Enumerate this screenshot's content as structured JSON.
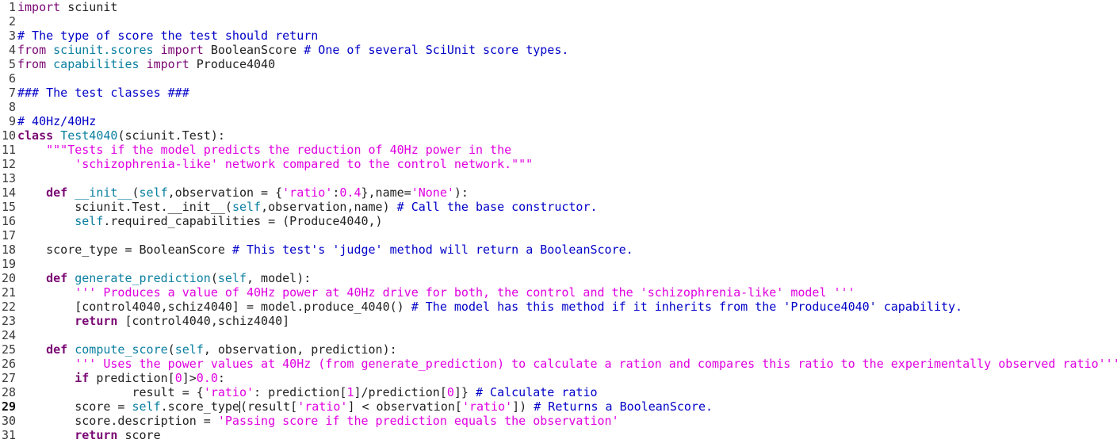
{
  "colors": {
    "keyword": "#7a0874",
    "comment": "#0000c8",
    "string": "#e000e0",
    "function": "#0a7fa0",
    "text": "#222222",
    "background": "#ffffff"
  },
  "editor": {
    "current_line": 29,
    "lines": [
      {
        "n": "1",
        "tokens": [
          [
            "imp",
            "import"
          ],
          [
            "plain",
            " sciunit"
          ]
        ]
      },
      {
        "n": "2",
        "tokens": []
      },
      {
        "n": "3",
        "tokens": [
          [
            "cmt",
            "# The type of score the test should return"
          ]
        ]
      },
      {
        "n": "4",
        "tokens": [
          [
            "imp",
            "from"
          ],
          [
            "plain",
            " "
          ],
          [
            "fn",
            "sciunit.scores"
          ],
          [
            "plain",
            " "
          ],
          [
            "imp",
            "import"
          ],
          [
            "plain",
            " BooleanScore "
          ],
          [
            "cmt",
            "# One of several SciUnit score types."
          ]
        ]
      },
      {
        "n": "5",
        "tokens": [
          [
            "imp",
            "from"
          ],
          [
            "plain",
            " "
          ],
          [
            "fn",
            "capabilities"
          ],
          [
            "plain",
            " "
          ],
          [
            "imp",
            "import"
          ],
          [
            "plain",
            " Produce4040"
          ]
        ]
      },
      {
        "n": "6",
        "tokens": []
      },
      {
        "n": "7",
        "tokens": [
          [
            "cmt",
            "### The test classes ###"
          ]
        ]
      },
      {
        "n": "8",
        "tokens": []
      },
      {
        "n": "9",
        "tokens": [
          [
            "cmt",
            "# 40Hz/40Hz"
          ]
        ]
      },
      {
        "n": "10",
        "tokens": [
          [
            "kw",
            "class"
          ],
          [
            "plain",
            " "
          ],
          [
            "fn",
            "Test4040"
          ],
          [
            "plain",
            "(sciunit.Test):"
          ]
        ]
      },
      {
        "n": "11",
        "tokens": [
          [
            "plain",
            "    "
          ],
          [
            "str",
            "\"\"\"Tests if the model predicts the reduction of 40Hz power in the"
          ]
        ]
      },
      {
        "n": "12",
        "tokens": [
          [
            "str",
            "        'schizophrenia-like' network compared to the control network.\"\"\""
          ]
        ]
      },
      {
        "n": "13",
        "tokens": []
      },
      {
        "n": "14",
        "tokens": [
          [
            "plain",
            "    "
          ],
          [
            "kw",
            "def"
          ],
          [
            "plain",
            " "
          ],
          [
            "fn",
            "__init__"
          ],
          [
            "plain",
            "("
          ],
          [
            "self",
            "self"
          ],
          [
            "plain",
            ",observation = {"
          ],
          [
            "str",
            "'ratio'"
          ],
          [
            "plain",
            ":"
          ],
          [
            "num",
            "0.4"
          ],
          [
            "plain",
            "},name="
          ],
          [
            "str",
            "'None'"
          ],
          [
            "plain",
            "):"
          ]
        ]
      },
      {
        "n": "15",
        "tokens": [
          [
            "plain",
            "        sciunit.Test.__init__("
          ],
          [
            "self",
            "self"
          ],
          [
            "plain",
            ",observation,name) "
          ],
          [
            "cmt",
            "# Call the base constructor."
          ]
        ]
      },
      {
        "n": "16",
        "tokens": [
          [
            "plain",
            "        "
          ],
          [
            "self",
            "self"
          ],
          [
            "plain",
            ".required_capabilities = (Produce4040,)"
          ]
        ]
      },
      {
        "n": "17",
        "tokens": []
      },
      {
        "n": "18",
        "tokens": [
          [
            "plain",
            "    score_type = BooleanScore "
          ],
          [
            "cmt",
            "# This test's 'judge' method will return a BooleanScore."
          ]
        ]
      },
      {
        "n": "19",
        "tokens": []
      },
      {
        "n": "20",
        "tokens": [
          [
            "plain",
            "    "
          ],
          [
            "kw",
            "def"
          ],
          [
            "plain",
            " "
          ],
          [
            "fn",
            "generate_prediction"
          ],
          [
            "plain",
            "("
          ],
          [
            "self",
            "self"
          ],
          [
            "plain",
            ", model):"
          ]
        ]
      },
      {
        "n": "21",
        "tokens": [
          [
            "plain",
            "        "
          ],
          [
            "str",
            "''' Produces a value of 40Hz power at 40Hz drive for both, the control and the 'schizophrenia-like' model '''"
          ]
        ]
      },
      {
        "n": "22",
        "tokens": [
          [
            "plain",
            "        [control4040,schiz4040] = model.produce_4040() "
          ],
          [
            "cmt",
            "# The model has this method if it inherits from the 'Produce4040' capability."
          ]
        ]
      },
      {
        "n": "23",
        "tokens": [
          [
            "plain",
            "        "
          ],
          [
            "kw",
            "return"
          ],
          [
            "plain",
            " [control4040,schiz4040]"
          ]
        ]
      },
      {
        "n": "24",
        "tokens": []
      },
      {
        "n": "25",
        "tokens": [
          [
            "plain",
            "    "
          ],
          [
            "kw",
            "def"
          ],
          [
            "plain",
            " "
          ],
          [
            "fn",
            "compute_score"
          ],
          [
            "plain",
            "("
          ],
          [
            "self",
            "self"
          ],
          [
            "plain",
            ", observation, prediction):"
          ]
        ]
      },
      {
        "n": "26",
        "tokens": [
          [
            "plain",
            "        "
          ],
          [
            "str",
            "''' Uses the power values at 40Hz (from generate_prediction) to calculate a ration and compares this ratio to the experimentally observed ratio'''"
          ]
        ]
      },
      {
        "n": "27",
        "tokens": [
          [
            "plain",
            "        "
          ],
          [
            "kw",
            "if"
          ],
          [
            "plain",
            " prediction["
          ],
          [
            "num",
            "0"
          ],
          [
            "plain",
            "]>"
          ],
          [
            "num",
            "0.0"
          ],
          [
            "plain",
            ":"
          ]
        ]
      },
      {
        "n": "28",
        "tokens": [
          [
            "plain",
            "                result = {"
          ],
          [
            "str",
            "'ratio'"
          ],
          [
            "plain",
            ": prediction["
          ],
          [
            "num",
            "1"
          ],
          [
            "plain",
            "]/prediction["
          ],
          [
            "num",
            "0"
          ],
          [
            "plain",
            "]} "
          ],
          [
            "cmt",
            "# Calculate ratio"
          ]
        ]
      },
      {
        "n": "29",
        "tokens": [
          [
            "plain",
            "        score = "
          ],
          [
            "self",
            "self"
          ],
          [
            "plain",
            ".score_type"
          ],
          [
            "caret",
            ""
          ],
          [
            "plain",
            "(result["
          ],
          [
            "str",
            "'ratio'"
          ],
          [
            "plain",
            "] < observation["
          ],
          [
            "str",
            "'ratio'"
          ],
          [
            "plain",
            "]) "
          ],
          [
            "cmt",
            "# Returns a BooleanScore."
          ]
        ]
      },
      {
        "n": "30",
        "tokens": [
          [
            "plain",
            "        score.description = "
          ],
          [
            "str",
            "'Passing score if the prediction equals the observation'"
          ]
        ]
      },
      {
        "n": "31",
        "tokens": [
          [
            "plain",
            "        "
          ],
          [
            "kw",
            "return"
          ],
          [
            "plain",
            " score"
          ]
        ]
      }
    ]
  }
}
